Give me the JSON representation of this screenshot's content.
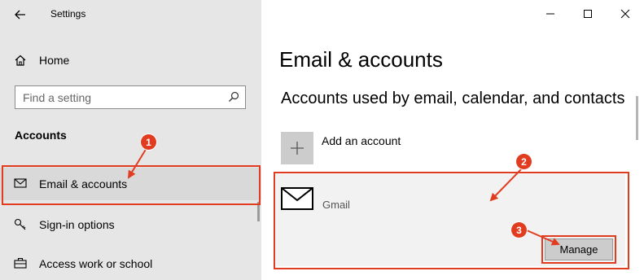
{
  "window": {
    "title": "Settings"
  },
  "sidebar": {
    "home_label": "Home",
    "search": {
      "placeholder": "Find a setting"
    },
    "section_heading": "Accounts",
    "items": [
      {
        "label": "Email & accounts",
        "icon": "mail-icon",
        "selected": true
      },
      {
        "label": "Sign-in options",
        "icon": "key-icon",
        "selected": false
      },
      {
        "label": "Access work or school",
        "icon": "briefcase-icon",
        "selected": false
      }
    ]
  },
  "main": {
    "title": "Email & accounts",
    "subtitle": "Accounts used by email, calendar, and contacts",
    "add_account_label": "Add an account",
    "account": {
      "name": "Gmail",
      "manage_label": "Manage"
    }
  },
  "annotations": {
    "badge1": "1",
    "badge2": "2",
    "badge3": "3",
    "color": "#e23c20"
  }
}
